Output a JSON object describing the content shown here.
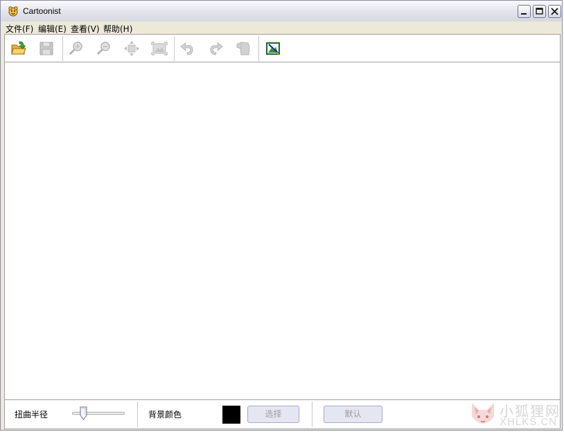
{
  "window": {
    "title": "Cartoonist",
    "icons": {
      "app": "cartoon-face-icon",
      "minimize": "minimize-icon",
      "maximize": "maximize-icon",
      "close": "close-icon"
    }
  },
  "menu": {
    "items": [
      {
        "label": "文件(F)"
      },
      {
        "label": "编辑(E)"
      },
      {
        "label": "查看(V)"
      },
      {
        "label": "帮助(H)"
      }
    ]
  },
  "toolbar": {
    "buttons": [
      {
        "icon": "open-folder-icon",
        "enabled": true
      },
      {
        "icon": "save-disk-icon",
        "enabled": false
      },
      {
        "icon": "zoom-in-icon",
        "enabled": false
      },
      {
        "icon": "zoom-out-icon",
        "enabled": false
      },
      {
        "icon": "fit-move-icon",
        "enabled": false
      },
      {
        "icon": "actual-size-icon",
        "enabled": false
      },
      {
        "icon": "undo-icon",
        "enabled": false
      },
      {
        "icon": "redo-icon",
        "enabled": false
      },
      {
        "icon": "reset-icon",
        "enabled": false
      },
      {
        "icon": "picture-edit-icon",
        "enabled": true
      }
    ]
  },
  "bottom": {
    "distortion_label": "扭曲半径",
    "slider_level": 0.22,
    "bg_color_label": "背景颜色",
    "bg_color": "#000000",
    "choose_button": "选择",
    "default_button": "默认"
  },
  "watermark": {
    "cn": "小狐狸网",
    "en": "XHLKS.CN",
    "icon": "fox-logo-icon"
  }
}
